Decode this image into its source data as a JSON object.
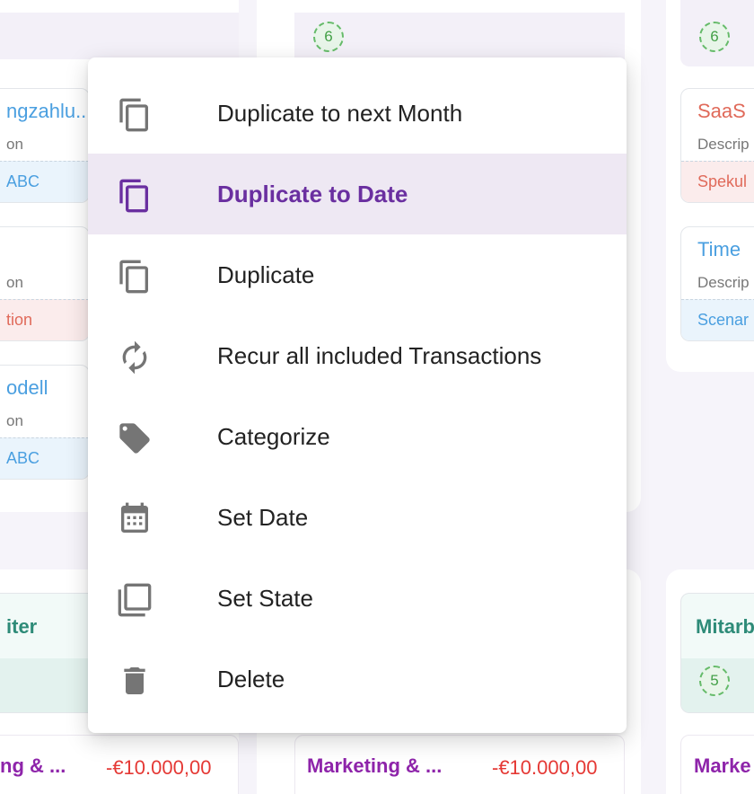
{
  "background": {
    "left_cards": [
      {
        "title": "ngzahlu...",
        "desc": "on",
        "tag": "ABC",
        "tag_tone": "blue"
      },
      {
        "title": "",
        "desc": "on",
        "tag": "tion",
        "tag_tone": "red"
      },
      {
        "title": "odell",
        "desc": "on",
        "tag": "ABC",
        "tag_tone": "blue"
      }
    ],
    "middle_badge": "6",
    "right_badge": "6",
    "right_cards": [
      {
        "title": "SaaS",
        "desc": "Descrip",
        "tag": "Spekul",
        "tone": "red"
      },
      {
        "title": "Time",
        "desc": "Descrip",
        "tag": "Scenar",
        "tone": "blue"
      }
    ],
    "left_group_title": "iter",
    "right_group_title": "Mitarb",
    "right_group_badge": "5",
    "footer": [
      {
        "label": "ng & ...",
        "amount": "-€10.000,00"
      },
      {
        "label": "Marketing & ...",
        "amount": "-€10.000,00"
      },
      {
        "label": "Marke",
        "amount": ""
      }
    ]
  },
  "menu": {
    "items": [
      {
        "label": "Duplicate to next Month",
        "icon": "copy-icon",
        "active": false
      },
      {
        "label": "Duplicate to Date",
        "icon": "copy-icon",
        "active": true
      },
      {
        "label": "Duplicate",
        "icon": "copy-icon",
        "active": false
      },
      {
        "label": "Recur all included Transactions",
        "icon": "refresh-icon",
        "active": false
      },
      {
        "label": "Categorize",
        "icon": "tag-icon",
        "active": false
      },
      {
        "label": "Set Date",
        "icon": "calendar-icon",
        "active": false
      },
      {
        "label": "Set State",
        "icon": "stacked-squares-icon",
        "active": false
      },
      {
        "label": "Delete",
        "icon": "trash-icon",
        "active": false
      }
    ],
    "colors": {
      "active_bg": "#eee8f3",
      "active_text": "#6a2fa0",
      "icon": "#757575"
    }
  }
}
